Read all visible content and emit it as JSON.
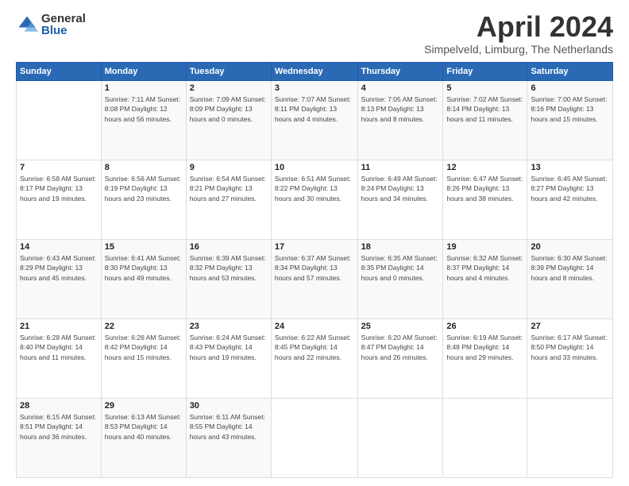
{
  "logo": {
    "general": "General",
    "blue": "Blue"
  },
  "header": {
    "month": "April 2024",
    "location": "Simpelveld, Limburg, The Netherlands"
  },
  "days_of_week": [
    "Sunday",
    "Monday",
    "Tuesday",
    "Wednesday",
    "Thursday",
    "Friday",
    "Saturday"
  ],
  "weeks": [
    [
      {
        "day": "",
        "info": ""
      },
      {
        "day": "1",
        "info": "Sunrise: 7:11 AM\nSunset: 8:08 PM\nDaylight: 12 hours\nand 56 minutes."
      },
      {
        "day": "2",
        "info": "Sunrise: 7:09 AM\nSunset: 8:09 PM\nDaylight: 13 hours\nand 0 minutes."
      },
      {
        "day": "3",
        "info": "Sunrise: 7:07 AM\nSunset: 8:11 PM\nDaylight: 13 hours\nand 4 minutes."
      },
      {
        "day": "4",
        "info": "Sunrise: 7:05 AM\nSunset: 8:13 PM\nDaylight: 13 hours\nand 8 minutes."
      },
      {
        "day": "5",
        "info": "Sunrise: 7:02 AM\nSunset: 8:14 PM\nDaylight: 13 hours\nand 11 minutes."
      },
      {
        "day": "6",
        "info": "Sunrise: 7:00 AM\nSunset: 8:16 PM\nDaylight: 13 hours\nand 15 minutes."
      }
    ],
    [
      {
        "day": "7",
        "info": "Sunrise: 6:58 AM\nSunset: 8:17 PM\nDaylight: 13 hours\nand 19 minutes."
      },
      {
        "day": "8",
        "info": "Sunrise: 6:56 AM\nSunset: 8:19 PM\nDaylight: 13 hours\nand 23 minutes."
      },
      {
        "day": "9",
        "info": "Sunrise: 6:54 AM\nSunset: 8:21 PM\nDaylight: 13 hours\nand 27 minutes."
      },
      {
        "day": "10",
        "info": "Sunrise: 6:51 AM\nSunset: 8:22 PM\nDaylight: 13 hours\nand 30 minutes."
      },
      {
        "day": "11",
        "info": "Sunrise: 6:49 AM\nSunset: 8:24 PM\nDaylight: 13 hours\nand 34 minutes."
      },
      {
        "day": "12",
        "info": "Sunrise: 6:47 AM\nSunset: 8:26 PM\nDaylight: 13 hours\nand 38 minutes."
      },
      {
        "day": "13",
        "info": "Sunrise: 6:45 AM\nSunset: 8:27 PM\nDaylight: 13 hours\nand 42 minutes."
      }
    ],
    [
      {
        "day": "14",
        "info": "Sunrise: 6:43 AM\nSunset: 8:29 PM\nDaylight: 13 hours\nand 45 minutes."
      },
      {
        "day": "15",
        "info": "Sunrise: 6:41 AM\nSunset: 8:30 PM\nDaylight: 13 hours\nand 49 minutes."
      },
      {
        "day": "16",
        "info": "Sunrise: 6:39 AM\nSunset: 8:32 PM\nDaylight: 13 hours\nand 53 minutes."
      },
      {
        "day": "17",
        "info": "Sunrise: 6:37 AM\nSunset: 8:34 PM\nDaylight: 13 hours\nand 57 minutes."
      },
      {
        "day": "18",
        "info": "Sunrise: 6:35 AM\nSunset: 8:35 PM\nDaylight: 14 hours\nand 0 minutes."
      },
      {
        "day": "19",
        "info": "Sunrise: 6:32 AM\nSunset: 8:37 PM\nDaylight: 14 hours\nand 4 minutes."
      },
      {
        "day": "20",
        "info": "Sunrise: 6:30 AM\nSunset: 8:39 PM\nDaylight: 14 hours\nand 8 minutes."
      }
    ],
    [
      {
        "day": "21",
        "info": "Sunrise: 6:28 AM\nSunset: 8:40 PM\nDaylight: 14 hours\nand 11 minutes."
      },
      {
        "day": "22",
        "info": "Sunrise: 6:26 AM\nSunset: 8:42 PM\nDaylight: 14 hours\nand 15 minutes."
      },
      {
        "day": "23",
        "info": "Sunrise: 6:24 AM\nSunset: 8:43 PM\nDaylight: 14 hours\nand 19 minutes."
      },
      {
        "day": "24",
        "info": "Sunrise: 6:22 AM\nSunset: 8:45 PM\nDaylight: 14 hours\nand 22 minutes."
      },
      {
        "day": "25",
        "info": "Sunrise: 6:20 AM\nSunset: 8:47 PM\nDaylight: 14 hours\nand 26 minutes."
      },
      {
        "day": "26",
        "info": "Sunrise: 6:19 AM\nSunset: 8:48 PM\nDaylight: 14 hours\nand 29 minutes."
      },
      {
        "day": "27",
        "info": "Sunrise: 6:17 AM\nSunset: 8:50 PM\nDaylight: 14 hours\nand 33 minutes."
      }
    ],
    [
      {
        "day": "28",
        "info": "Sunrise: 6:15 AM\nSunset: 8:51 PM\nDaylight: 14 hours\nand 36 minutes."
      },
      {
        "day": "29",
        "info": "Sunrise: 6:13 AM\nSunset: 8:53 PM\nDaylight: 14 hours\nand 40 minutes."
      },
      {
        "day": "30",
        "info": "Sunrise: 6:11 AM\nSunset: 8:55 PM\nDaylight: 14 hours\nand 43 minutes."
      },
      {
        "day": "",
        "info": ""
      },
      {
        "day": "",
        "info": ""
      },
      {
        "day": "",
        "info": ""
      },
      {
        "day": "",
        "info": ""
      }
    ]
  ]
}
